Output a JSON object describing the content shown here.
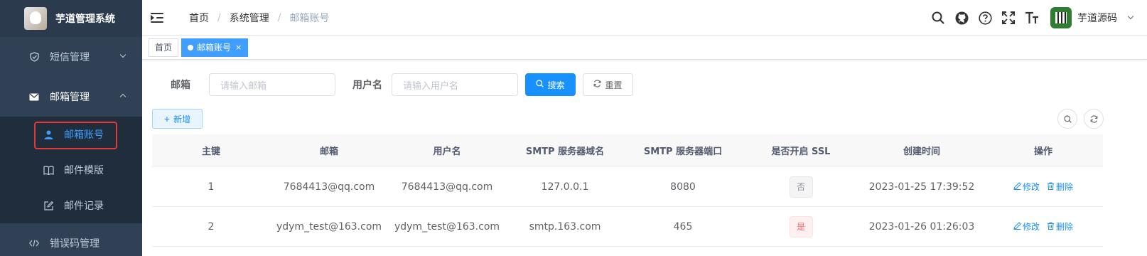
{
  "app": {
    "title": "芋道管理系统"
  },
  "sidebar": {
    "items": [
      {
        "label": "短信管理",
        "icon": "shield-icon",
        "expanded": false
      },
      {
        "label": "邮箱管理",
        "icon": "mail-icon",
        "expanded": true,
        "children": [
          {
            "label": "邮箱账号",
            "icon": "user-icon",
            "active": true
          },
          {
            "label": "邮件模版",
            "icon": "book-icon",
            "active": false
          },
          {
            "label": "邮件记录",
            "icon": "edit-icon",
            "active": false
          }
        ]
      },
      {
        "label": "错误码管理",
        "icon": "code-icon",
        "expanded": false
      }
    ]
  },
  "navbar": {
    "breadcrumb": [
      "首页",
      "系统管理",
      "邮箱账号"
    ],
    "icons": [
      "search-icon",
      "github-icon",
      "help-icon",
      "fullscreen-icon",
      "font-size-icon"
    ],
    "user_name": "芋道源码"
  },
  "tags": [
    {
      "label": "首页",
      "active": false
    },
    {
      "label": "邮箱账号",
      "active": true,
      "close": "×"
    }
  ],
  "search": {
    "email_label": "邮箱",
    "email_placeholder": "请输入邮箱",
    "username_label": "用户名",
    "username_placeholder": "请输入用户名",
    "search_button": "搜索",
    "reset_button": "重置"
  },
  "toolbar": {
    "add_button": "新增"
  },
  "table": {
    "columns": [
      "主键",
      "邮箱",
      "用户名",
      "SMTP 服务器域名",
      "SMTP 服务器端口",
      "是否开启 SSL",
      "创建时间",
      "操作"
    ],
    "rows": [
      {
        "id": "1",
        "email": "7684413@qq.com",
        "username": "7684413@qq.com",
        "host": "127.0.0.1",
        "port": "8080",
        "ssl": "否",
        "ssl_on": false,
        "created": "2023-01-25 17:39:52"
      },
      {
        "id": "2",
        "email": "ydym_test@163.com",
        "username": "ydym_test@163.com",
        "host": "smtp.163.com",
        "port": "465",
        "ssl": "是",
        "ssl_on": true,
        "created": "2023-01-26 01:26:03"
      }
    ],
    "actions": {
      "edit": "修改",
      "delete": "删除"
    }
  },
  "colors": {
    "primary": "#1890ff",
    "sidebar_bg": "#304156",
    "active_menu": "#409eff",
    "danger": "#f56c6c"
  }
}
